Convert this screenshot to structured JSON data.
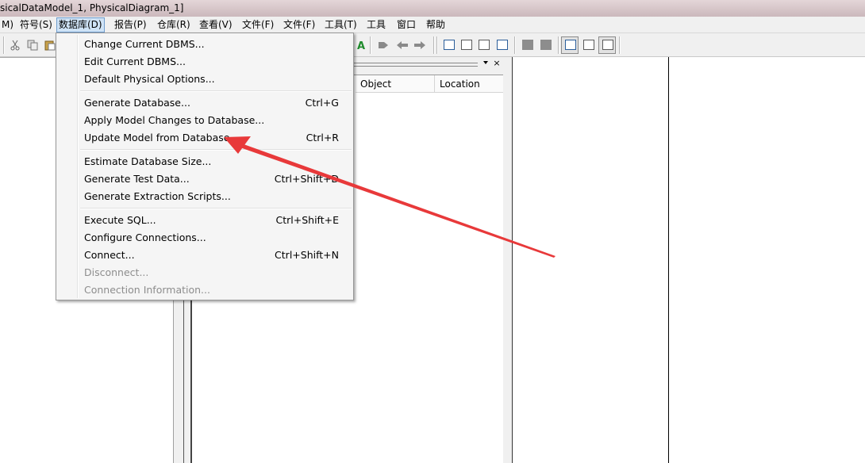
{
  "window": {
    "title": "sicalDataModel_1, PhysicalDiagram_1]"
  },
  "menubar": {
    "items": [
      {
        "label": "M)"
      },
      {
        "label": "符号(S)"
      },
      {
        "label": "数据库(D)"
      },
      {
        "label": "报告(P)"
      },
      {
        "label": "仓库(R)"
      },
      {
        "label": "查看(V)"
      },
      {
        "label": "文件(F)"
      },
      {
        "label": "文件(F)"
      },
      {
        "label": "工具(T)"
      },
      {
        "label": "工具"
      },
      {
        "label": "窗口"
      },
      {
        "label": "帮助"
      }
    ]
  },
  "toolbar": {
    "icons": [
      "cut-icon",
      "copy-icon",
      "paste-icon",
      "text-color-icon",
      "tool-icon",
      "back-icon",
      "forward-icon",
      "view-icon-1",
      "view-icon-2",
      "view-icon-3",
      "view-icon-4",
      "view-icon-5",
      "view-icon-6",
      "preview-icon",
      "list-icon",
      "table-icon"
    ]
  },
  "output_panel": {
    "close_glyph": "×",
    "columns": [
      "Object",
      "Location"
    ]
  },
  "database_menu": {
    "items": [
      {
        "label": "Change Current DBMS...",
        "shortcut": "",
        "enabled": true
      },
      {
        "label": "Edit Current DBMS...",
        "shortcut": "",
        "enabled": true
      },
      {
        "label": "Default Physical Options...",
        "shortcut": "",
        "enabled": true
      },
      {
        "label": "Generate Database...",
        "shortcut": "Ctrl+G",
        "enabled": true
      },
      {
        "label": "Apply Model Changes to Database...",
        "shortcut": "",
        "enabled": true
      },
      {
        "label": "Update Model from Database...",
        "shortcut": "Ctrl+R",
        "enabled": true
      },
      {
        "label": "Estimate Database Size...",
        "shortcut": "",
        "enabled": true
      },
      {
        "label": "Generate Test Data...",
        "shortcut": "Ctrl+Shift+D",
        "enabled": true
      },
      {
        "label": "Generate Extraction Scripts...",
        "shortcut": "",
        "enabled": true
      },
      {
        "label": "Execute SQL...",
        "shortcut": "Ctrl+Shift+E",
        "enabled": true
      },
      {
        "label": "Configure Connections...",
        "shortcut": "",
        "enabled": true
      },
      {
        "label": "Connect...",
        "shortcut": "Ctrl+Shift+N",
        "enabled": true
      },
      {
        "label": "Disconnect...",
        "shortcut": "",
        "enabled": false
      },
      {
        "label": "Connection Information...",
        "shortcut": "",
        "enabled": false
      }
    ]
  },
  "annotation": {
    "arrow_color": "#e8393a",
    "points_to": "Update Model from Database..."
  }
}
